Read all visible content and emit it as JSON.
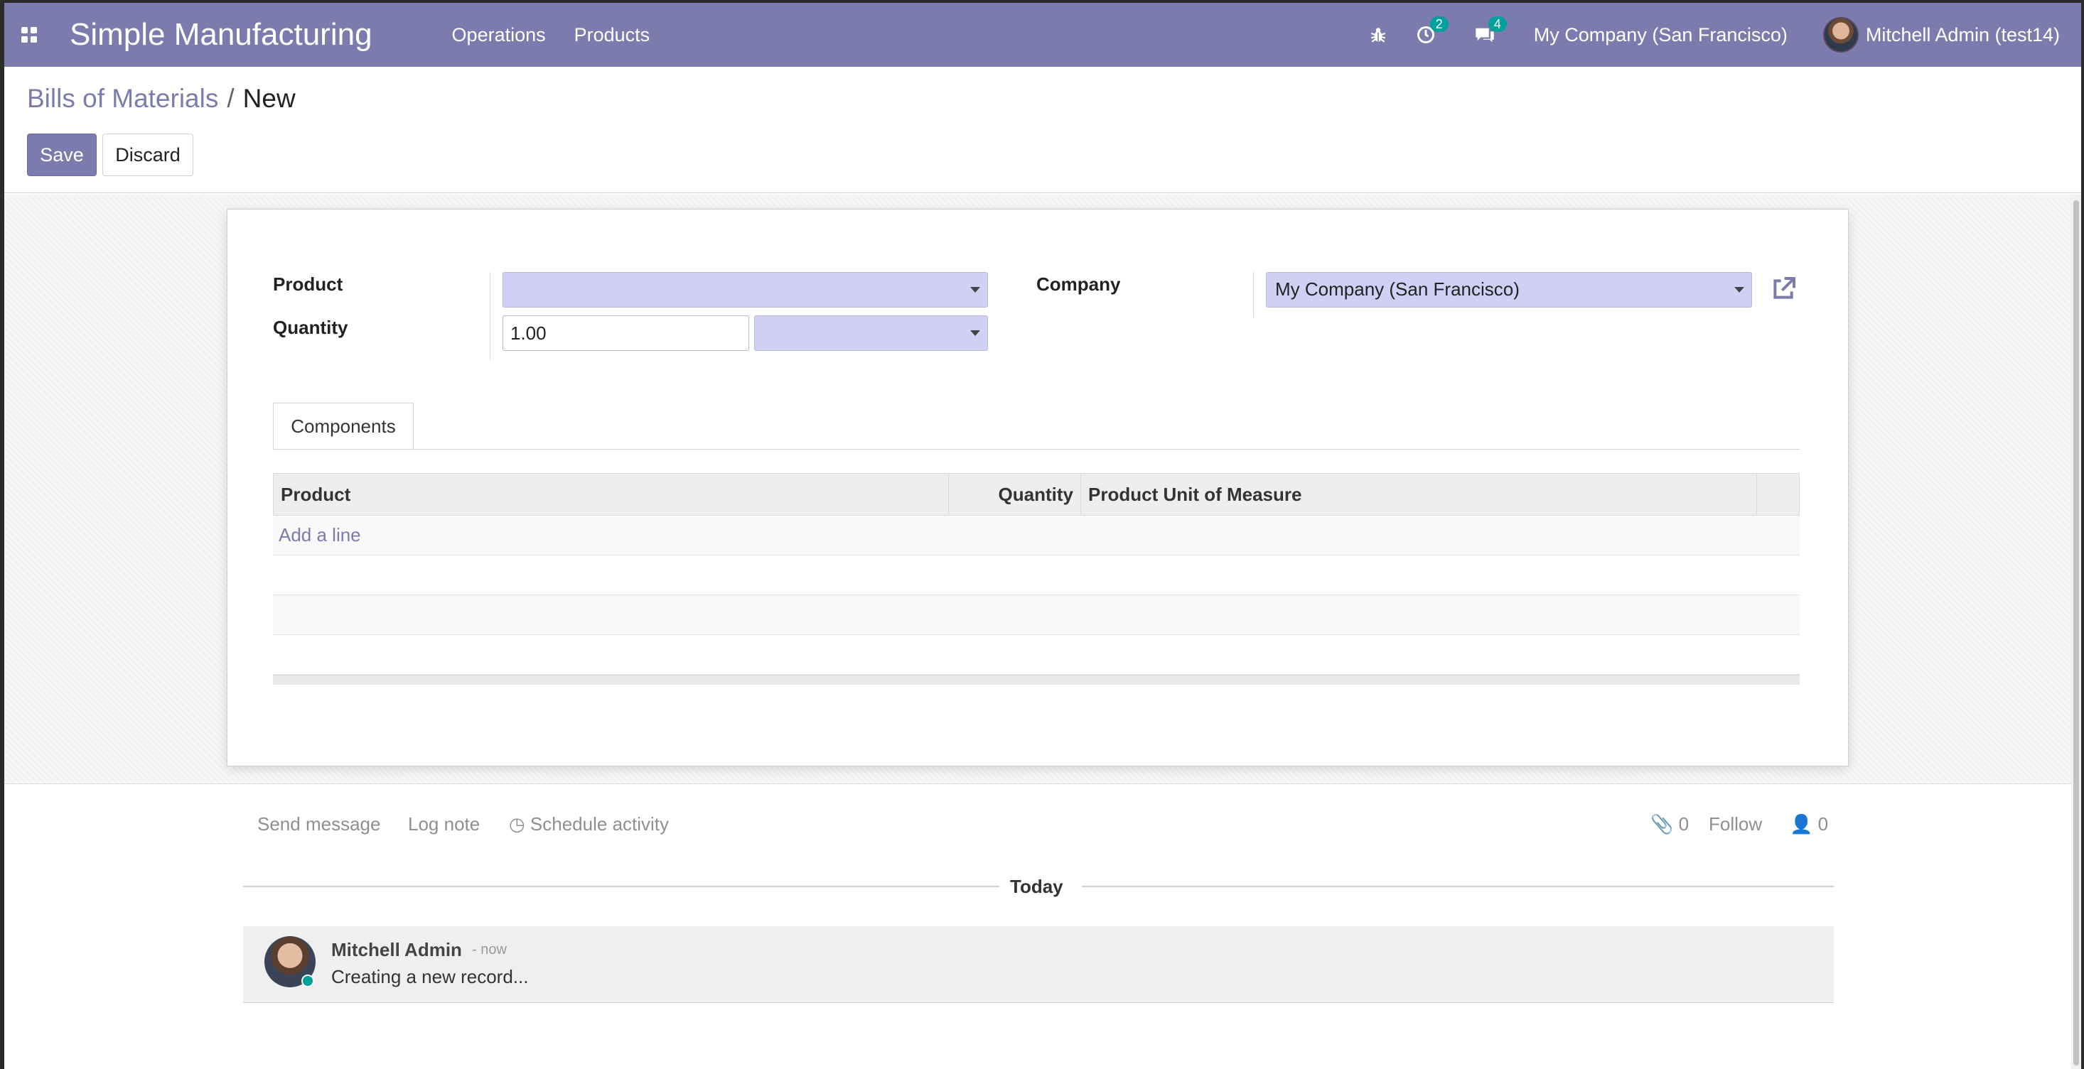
{
  "navbar": {
    "brand": "Simple Manufacturing",
    "menus": [
      "Operations",
      "Products"
    ],
    "activity_count": "2",
    "message_count": "4",
    "company": "My Company (San Francisco)",
    "user": "Mitchell Admin (test14)",
    "icons": [
      "apps-grid-icon",
      "bug-icon",
      "activity-clock-icon",
      "chat-icon"
    ]
  },
  "breadcrumb": {
    "parent": "Bills of Materials",
    "separator": "/",
    "current": "New"
  },
  "buttons": {
    "save": "Save",
    "discard": "Discard"
  },
  "form": {
    "product_label": "Product",
    "product_value": "",
    "quantity_label": "Quantity",
    "quantity_value": "1.00",
    "uom_value": "",
    "company_label": "Company",
    "company_value": "My Company (San Francisco)"
  },
  "tabs": [
    "Components"
  ],
  "components_table": {
    "columns": [
      "Product",
      "Quantity",
      "Product Unit of Measure"
    ],
    "add_line": "Add a line",
    "rows": []
  },
  "chatter": {
    "send_message": "Send message",
    "log_note": "Log note",
    "schedule_activity": "Schedule activity",
    "attachments": "0",
    "follow": "Follow",
    "followers": "0",
    "date_separator": "Today",
    "messages": [
      {
        "author": "Mitchell Admin",
        "time": "- now",
        "body": "Creating a new record..."
      }
    ]
  },
  "colors": {
    "brand": "#7c7bad",
    "badge": "#00a09d",
    "required_field": "#d0d0f5"
  }
}
